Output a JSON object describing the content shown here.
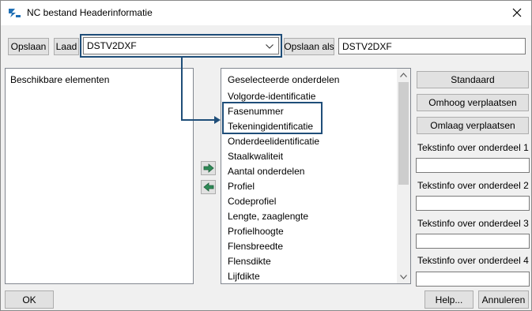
{
  "window": {
    "title": "NC bestand Headerinformatie"
  },
  "toolbar": {
    "save_label": "Opslaan",
    "load_label": "Laad",
    "preset_selected": "DSTV2DXF",
    "save_as_label": "Opslaan als",
    "save_as_value": "DSTV2DXF"
  },
  "available": {
    "header": "Beschikbare elementen"
  },
  "selected": {
    "header": "Geselecteerde onderdelen",
    "items": [
      "Volgorde-identificatie",
      "Fasenummer",
      "Tekeningidentificatie",
      "Onderdeelidentificatie",
      "Staalkwaliteit",
      "Aantal onderdelen",
      "Profiel",
      "Codeprofiel",
      "Lengte, zaaglengte",
      "Profielhoogte",
      "Flensbreedte",
      "Flensdikte",
      "Lijfdikte"
    ]
  },
  "side": {
    "standard_label": "Standaard",
    "move_up_label": "Omhoog verplaatsen",
    "move_down_label": "Omlaag verplaatsen",
    "text_info": [
      {
        "label": "Tekstinfo over onderdeel 1",
        "value": ""
      },
      {
        "label": "Tekstinfo over onderdeel 2",
        "value": ""
      },
      {
        "label": "Tekstinfo over onderdeel 3",
        "value": ""
      },
      {
        "label": "Tekstinfo over onderdeel 4",
        "value": ""
      }
    ]
  },
  "footer": {
    "ok_label": "OK",
    "help_label": "Help...",
    "cancel_label": "Annuleren"
  },
  "colors": {
    "highlight": "#1f4e79",
    "arrow_green": "#2e8b57"
  }
}
